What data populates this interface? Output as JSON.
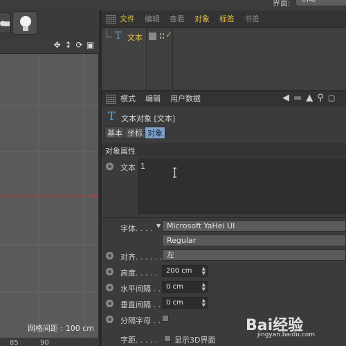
{
  "top": {
    "layout_label": "界面:",
    "layout_value": "启动"
  },
  "viewport": {
    "nav_icons": [
      "move-icon",
      "zoom-icon",
      "rotate-icon",
      "maximize-icon"
    ],
    "grid_label": "网格间距 : 100 cm",
    "coord_a": "85",
    "coord_b": "90"
  },
  "object_manager": {
    "menu": [
      {
        "label": "文件",
        "color": "#e8c54a"
      },
      {
        "label": "编辑",
        "color": "#8c8c8c"
      },
      {
        "label": "查看",
        "color": "#8c8c8c"
      },
      {
        "label": "对象",
        "color": "#e8c54a"
      },
      {
        "label": "标签",
        "color": "#e8c54a"
      },
      {
        "label": "书签",
        "color": "#8c8c8c"
      }
    ],
    "object_name": "文本"
  },
  "attribute_manager": {
    "menu": [
      "模式",
      "编辑",
      "用户数据"
    ],
    "title": "文本对象 [文本]",
    "tabs": [
      "基本",
      "坐标",
      "对象"
    ],
    "active_tab": "对象",
    "section": "对象属性",
    "text_label": "文本",
    "text_value": "1",
    "font_label": "字体. . . .",
    "font_value": "Microsoft YaHei UI",
    "font_style": "Regular",
    "align_label": "对齐. . . . . .",
    "align_value": "左",
    "height_label": "高度. . . . .",
    "height_value": "200 cm",
    "hspace_label": "水平间隔 . .",
    "hspace_value": "0 cm",
    "vspace_label": "垂直间隔 . .",
    "vspace_value": "0 cm",
    "separate_label": "分隔字母 . .",
    "kerning_label": "字距. . . . .",
    "show3d_label": "显示3D界面"
  },
  "watermark": {
    "text": "Bai经验",
    "url": "jingyan.baidu.com"
  },
  "colors": {
    "accent_tab": "#7ea1cc",
    "x_axis": "#c0393b",
    "object_icon": "#5aa8e0"
  }
}
